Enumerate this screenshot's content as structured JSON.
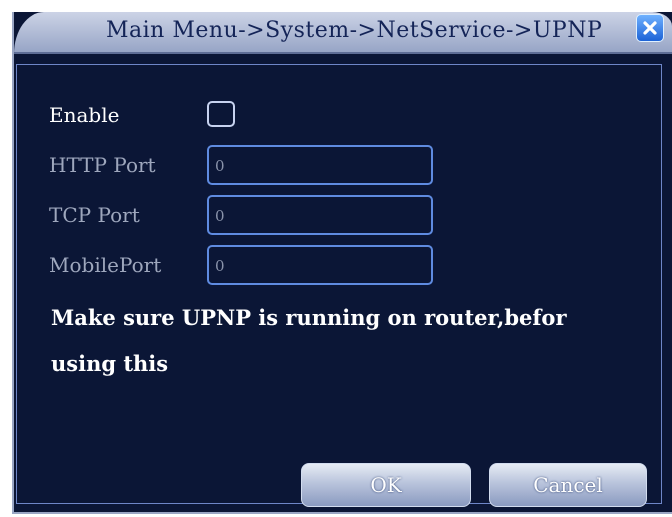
{
  "window": {
    "title": "Main Menu->System->NetService->UPNP"
  },
  "form": {
    "enable_label": "Enable",
    "enable_checked": false,
    "http_port_label": "HTTP Port",
    "http_port_value": "0",
    "tcp_port_label": "TCP Port",
    "tcp_port_value": "0",
    "mobile_port_label": "MobilePort",
    "mobile_port_value": "0"
  },
  "message": {
    "line1": "Make sure UPNP is running on router,befor",
    "line2": "using this"
  },
  "buttons": {
    "ok_label": "OK",
    "cancel_label": "Cancel"
  },
  "icons": {
    "close": "close-icon"
  },
  "colors": {
    "background": "#0b1636",
    "field_border": "#5f8be0",
    "title_text": "#142457",
    "close_button": "#1c62d6"
  }
}
